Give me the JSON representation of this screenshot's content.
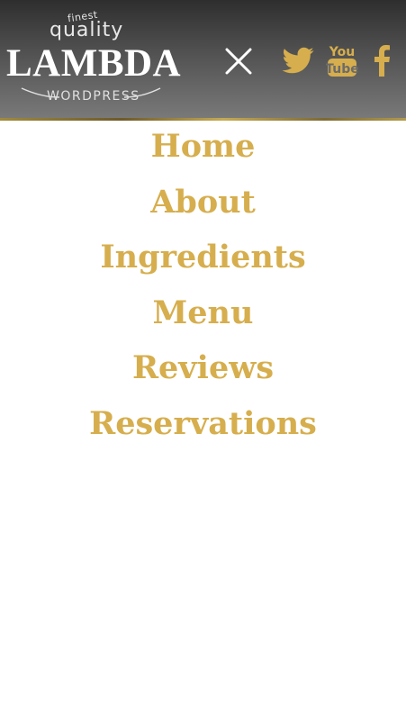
{
  "logo": {
    "top_small": "finest",
    "top_large": "quality",
    "brand": "LAMBDA",
    "sub": "WORDPRESS"
  },
  "header": {
    "close_icon": "close-icon",
    "social": [
      {
        "name": "twitter",
        "icon": "twitter-icon",
        "color": "#d6ae4d"
      },
      {
        "name": "youtube",
        "icon": "youtube-icon",
        "label_top": "You",
        "label_bottom": "Tube",
        "color": "#d6ae4d"
      },
      {
        "name": "facebook",
        "icon": "facebook-icon",
        "color": "#d6ae4d"
      }
    ]
  },
  "menu": {
    "items": [
      {
        "label": "Home"
      },
      {
        "label": "About"
      },
      {
        "label": "Ingredients"
      },
      {
        "label": "Menu"
      },
      {
        "label": "Reviews"
      },
      {
        "label": "Reservations"
      }
    ]
  },
  "colors": {
    "accent": "#d6ae4d",
    "header_dark": "#2e2e2e",
    "header_light": "#7a7a7a",
    "logo_text": "#ffffff"
  }
}
